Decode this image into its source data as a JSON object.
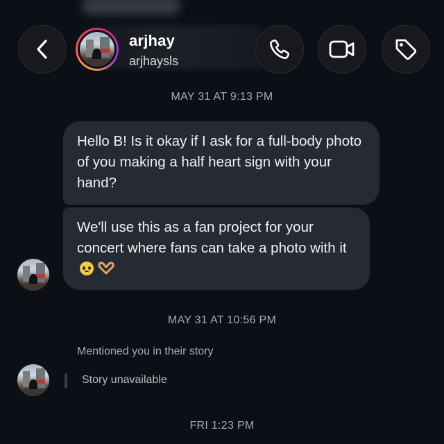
{
  "header": {
    "name": "arjhay",
    "username": "arjhaysls",
    "icons": {
      "back": "chevron-left-icon",
      "call": "phone-icon",
      "video": "video-camera-icon",
      "tag": "tag-icon"
    }
  },
  "thread": {
    "timestamp_1": "MAY 31 AT 9:13 PM",
    "message_1": "Hello B! Is it okay if I ask for a full-body photo of you making a half heart sign with your hand?",
    "message_2": "We'll use this as a fan project for your concert where fans can take a photo with it",
    "message_2_emojis": [
      "pleading-face-emoji",
      "heart-hands-emoji"
    ],
    "timestamp_2": "MAY 31 AT 10:56 PM",
    "mention_note": "Mentioned you in their story",
    "story_status": "Story unavailable",
    "timestamp_3": "FRI 1:23 PM"
  },
  "colors": {
    "background": "#0c0f16",
    "bubble": "#262a33",
    "muted_text": "#a9abb1",
    "ring_gradient": [
      "#f9a33a",
      "#f24b5b",
      "#d3287b",
      "#8e3bd6"
    ]
  }
}
